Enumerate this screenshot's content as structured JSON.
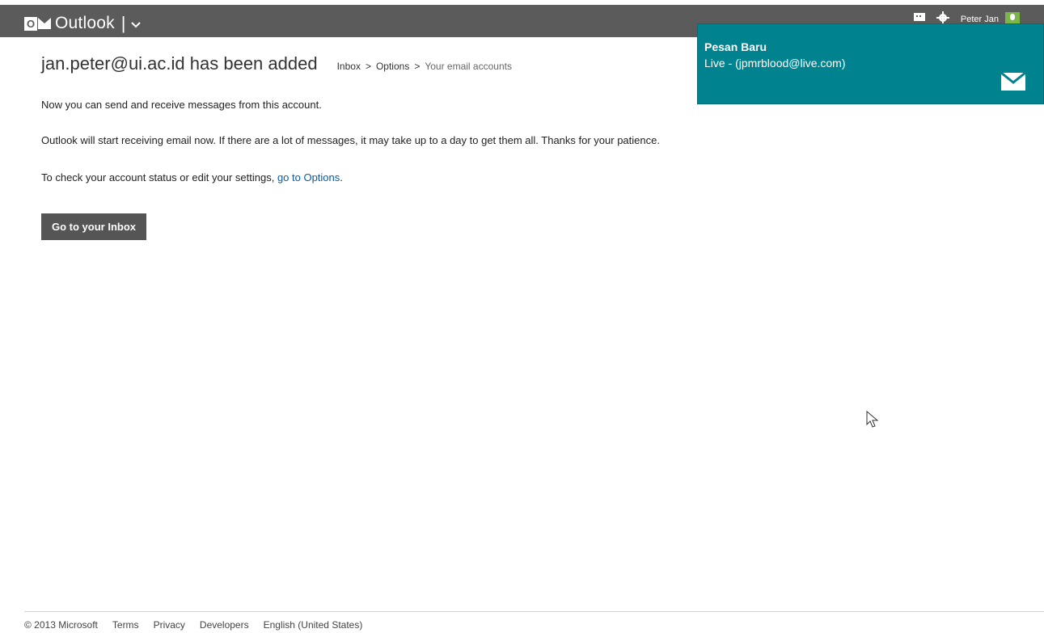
{
  "app": {
    "logo_letter": "O",
    "name": "Outlook",
    "separator": "|",
    "menu_chevron": "⌄"
  },
  "topbar": {
    "user_name": "Peter Jan",
    "icons": [
      "messaging-icon",
      "gear-icon",
      "avatar"
    ]
  },
  "page": {
    "title": "jan.peter@ui.ac.id has been added",
    "breadcrumb": [
      {
        "label": "Inbox"
      },
      {
        "label": "Options"
      },
      {
        "label": "Your email accounts"
      }
    ],
    "breadcrumb_separator": ">",
    "paragraph_1": "Now you can send and receive messages from this account.",
    "paragraph_2": "Outlook will start receiving email now. If there are a lot of messages, it may take up to a day to get them all. Thanks for your patience.",
    "paragraph_3_prefix": "To check your account status or edit your settings, ",
    "paragraph_3_link": "go to Options",
    "paragraph_3_suffix": ".",
    "inbox_button": "Go to your Inbox"
  },
  "notification": {
    "title": "Pesan Baru",
    "subtitle": "Live - (jpmrblood@live.com)",
    "icon": "mail-icon",
    "background": "#00828f"
  },
  "footer": {
    "copyright": "© 2013 Microsoft",
    "links": [
      "Terms",
      "Privacy",
      "Developers",
      "English (United States)"
    ]
  },
  "colors": {
    "topbar": "#5b5b5b",
    "link": "#0a5a9c",
    "button": "#555555",
    "notification": "#00828f"
  }
}
